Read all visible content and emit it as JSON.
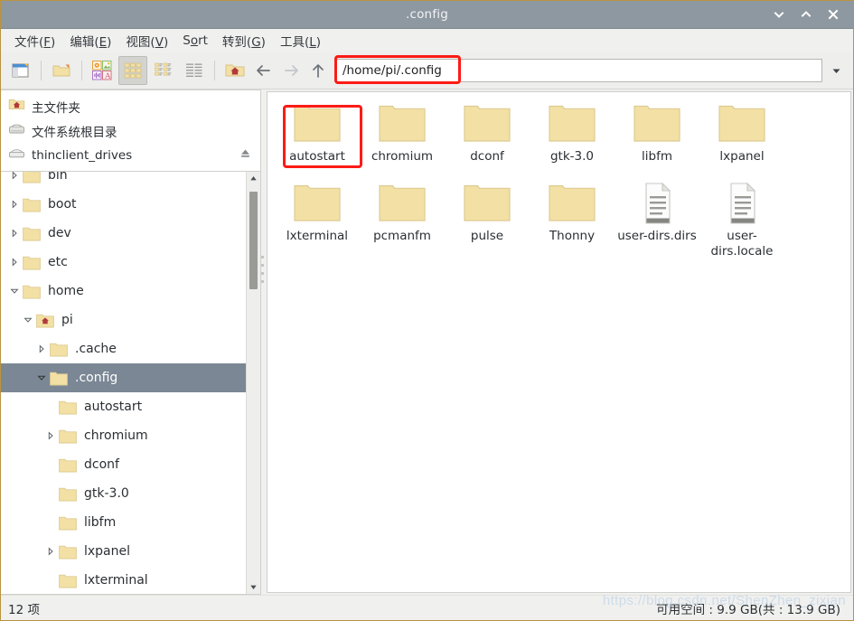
{
  "window": {
    "title": ".config",
    "controls": [
      {
        "name": "minimize",
        "glyph": "chevron-down"
      },
      {
        "name": "maximize",
        "glyph": "chevron-up"
      },
      {
        "name": "close",
        "glyph": "x"
      }
    ]
  },
  "menubar": {
    "items": [
      {
        "label": "文件(F)",
        "pre": "文件(",
        "mnemonic": "F",
        "post": ")"
      },
      {
        "label": "编辑(E)",
        "pre": "编辑(",
        "mnemonic": "E",
        "post": ")"
      },
      {
        "label": "视图(V)",
        "pre": "视图(",
        "mnemonic": "V",
        "post": ")"
      },
      {
        "label": "Sort",
        "pre": "S",
        "mnemonic": "o",
        "post": "rt"
      },
      {
        "label": "转到(G)",
        "pre": "转到(",
        "mnemonic": "G",
        "post": ")"
      },
      {
        "label": "工具(L)",
        "pre": "工具(",
        "mnemonic": "L",
        "post": ")"
      }
    ]
  },
  "toolbar": {
    "buttons": [
      {
        "name": "new-window-icon",
        "title": "新建窗口"
      },
      {
        "name": "new-folder-icon",
        "title": "新建文件夹"
      },
      {
        "name": "file-types-icon",
        "title": "文件类型"
      },
      {
        "name": "icon-view-icon",
        "title": "图标视图",
        "active": true
      },
      {
        "name": "detailed-list-view-icon",
        "title": "详细列表视图",
        "active": false
      },
      {
        "name": "compact-view-icon",
        "title": "紧凑视图",
        "active": false
      },
      {
        "name": "home-folder-icon",
        "title": "主文件夹"
      }
    ],
    "nav": [
      {
        "name": "back-arrow-icon",
        "enabled": true
      },
      {
        "name": "forward-arrow-icon",
        "enabled": false
      },
      {
        "name": "up-arrow-icon",
        "enabled": true
      }
    ]
  },
  "pathbar": {
    "value": "/home/pi/.config",
    "placeholder": "",
    "dropdown_icon": "chevron-down-icon"
  },
  "sidebar": {
    "places": [
      {
        "label": "主文件夹",
        "icon": "home-folder-icon",
        "eject": false
      },
      {
        "label": "文件系统根目录",
        "icon": "hard-drive-icon",
        "eject": false
      },
      {
        "label": "thinclient_drives",
        "icon": "drive-icon",
        "eject": true
      }
    ],
    "tree": [
      {
        "label": "bin",
        "depth": 0,
        "twisty": "collapsed",
        "icon": "folder-icon",
        "selected": false,
        "clipped": "top"
      },
      {
        "label": "boot",
        "depth": 0,
        "twisty": "collapsed",
        "icon": "folder-icon",
        "selected": false
      },
      {
        "label": "dev",
        "depth": 0,
        "twisty": "collapsed",
        "icon": "folder-icon",
        "selected": false
      },
      {
        "label": "etc",
        "depth": 0,
        "twisty": "collapsed",
        "icon": "folder-icon",
        "selected": false
      },
      {
        "label": "home",
        "depth": 0,
        "twisty": "expanded",
        "icon": "folder-icon",
        "selected": false
      },
      {
        "label": "pi",
        "depth": 1,
        "twisty": "expanded",
        "icon": "home-folder-icon",
        "selected": false
      },
      {
        "label": ".cache",
        "depth": 2,
        "twisty": "collapsed",
        "icon": "folder-icon",
        "selected": false
      },
      {
        "label": ".config",
        "depth": 2,
        "twisty": "expanded",
        "icon": "folder-icon",
        "selected": true
      },
      {
        "label": "autostart",
        "depth": 3,
        "twisty": "none",
        "icon": "folder-icon",
        "selected": false
      },
      {
        "label": "chromium",
        "depth": 3,
        "twisty": "collapsed",
        "icon": "folder-icon",
        "selected": false
      },
      {
        "label": "dconf",
        "depth": 3,
        "twisty": "none",
        "icon": "folder-icon",
        "selected": false
      },
      {
        "label": "gtk-3.0",
        "depth": 3,
        "twisty": "none",
        "icon": "folder-icon",
        "selected": false
      },
      {
        "label": "libfm",
        "depth": 3,
        "twisty": "none",
        "icon": "folder-icon",
        "selected": false
      },
      {
        "label": "lxpanel",
        "depth": 3,
        "twisty": "collapsed",
        "icon": "folder-icon",
        "selected": false
      },
      {
        "label": "lxterminal",
        "depth": 3,
        "twisty": "none",
        "icon": "folder-icon",
        "selected": false,
        "clipped": "bottom"
      }
    ]
  },
  "filepane": {
    "items": [
      {
        "name": "autostart",
        "type": "folder",
        "annotated": true
      },
      {
        "name": "chromium",
        "type": "folder"
      },
      {
        "name": "dconf",
        "type": "folder"
      },
      {
        "name": "gtk-3.0",
        "type": "folder"
      },
      {
        "name": "libfm",
        "type": "folder"
      },
      {
        "name": "lxpanel",
        "type": "folder"
      },
      {
        "name": "lxterminal",
        "type": "folder"
      },
      {
        "name": "pcmanfm",
        "type": "folder"
      },
      {
        "name": "pulse",
        "type": "folder"
      },
      {
        "name": "Thonny",
        "type": "folder"
      },
      {
        "name": "user-dirs.dirs",
        "type": "document"
      },
      {
        "name": "user-dirs.locale",
        "type": "document"
      }
    ]
  },
  "statusbar": {
    "count": "12 项",
    "free_space": "可用空间 : 9.9 GB(共 : 13.9 GB)",
    "watermark": "https://blog.csdn.net/ShenZhen_zixian"
  },
  "colors": {
    "titlebar": "#8e98a1",
    "selection": "#7b8794",
    "annotation": "#fc1b15",
    "folder": "#f3e0a4",
    "window_border": "#b9933f"
  }
}
